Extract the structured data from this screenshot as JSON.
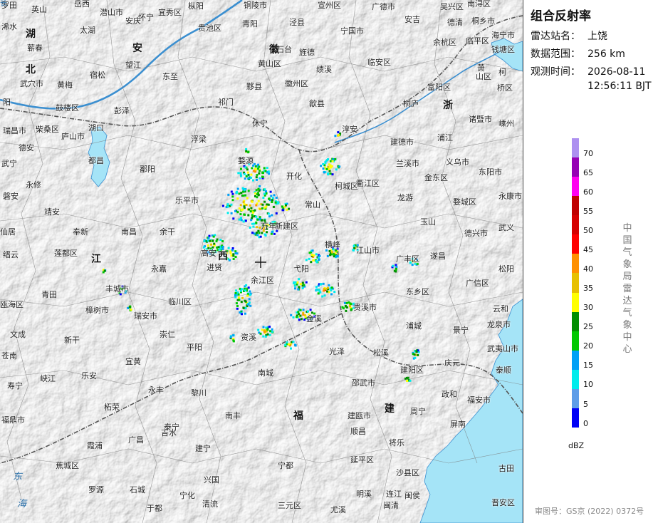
{
  "panel": {
    "title": "组合反射率",
    "station_label": "雷达站名：",
    "station_value": "上饶",
    "range_label": "数据范围：",
    "range_value": "256 km",
    "time_label": "观测时间：",
    "time_date": "2026-08-11",
    "time_clock": "12:56:11 BJT",
    "unit": "dBZ",
    "org": "中国气象局雷达气象中心",
    "approval": "审图号：GS京 (2022) 0372号"
  },
  "legend": {
    "ticks": [
      "70",
      "65",
      "60",
      "55",
      "50",
      "45",
      "40",
      "35",
      "30",
      "25",
      "20",
      "15",
      "10",
      "5",
      "0"
    ],
    "colors": [
      "#ad90f0",
      "#9600b4",
      "#ff00f0",
      "#c00000",
      "#d60000",
      "#ff0000",
      "#ff9000",
      "#e7c000",
      "#ffff00",
      "#008e00",
      "#00c800",
      "#01a0f6",
      "#00ecec",
      "#5d9de8",
      "#0000f6"
    ]
  },
  "colors": {
    "background_terrain": "#d9d9d9",
    "water": "#a5e4f7",
    "boundary": "#6f6f6f"
  },
  "icons": {
    "radar_site": "crosshair-icon"
  },
  "places": [
    {
      "t": "罗田"
    },
    {
      "t": "英山"
    },
    {
      "t": "岳西"
    },
    {
      "t": "潜山市"
    },
    {
      "t": "怀宁"
    },
    {
      "t": "宜秀区"
    },
    {
      "t": "枞阳"
    },
    {
      "t": "铜陵市"
    },
    {
      "t": "宣州区"
    },
    {
      "t": "广德市"
    },
    {
      "t": "吴兴区"
    },
    {
      "t": "南浔区"
    },
    {
      "t": "浠水"
    },
    {
      "t": "湖"
    },
    {
      "t": "太湖"
    },
    {
      "t": "安庆"
    },
    {
      "t": "贵池区"
    },
    {
      "t": "青阳"
    },
    {
      "t": "泾县"
    },
    {
      "t": "宁国市"
    },
    {
      "t": "安吉"
    },
    {
      "t": "德清"
    },
    {
      "t": "桐乡市"
    },
    {
      "t": "海宁市"
    },
    {
      "t": "蕲春"
    },
    {
      "t": "安"
    },
    {
      "t": "望江"
    },
    {
      "t": "石台"
    },
    {
      "t": "黄山区"
    },
    {
      "t": "徽"
    },
    {
      "t": "旌德"
    },
    {
      "t": "余杭区"
    },
    {
      "t": "临平区"
    },
    {
      "t": "钱塘区"
    },
    {
      "t": "北"
    },
    {
      "t": "宿松"
    },
    {
      "t": "东至"
    },
    {
      "t": "绩溪"
    },
    {
      "t": "临安区"
    },
    {
      "t": "萧"
    },
    {
      "t": "柯"
    },
    {
      "t": "武穴市"
    },
    {
      "t": "黄梅"
    },
    {
      "t": "黟县"
    },
    {
      "t": "徽州区"
    },
    {
      "t": "富阳区"
    },
    {
      "t": "山区"
    },
    {
      "t": "桥区"
    },
    {
      "t": "阳"
    },
    {
      "t": "彭泽"
    },
    {
      "t": "祁门"
    },
    {
      "t": "歙县"
    },
    {
      "t": "桐庐"
    },
    {
      "t": "浙"
    },
    {
      "t": "瑞昌市"
    },
    {
      "t": "柴桑区"
    },
    {
      "t": "湖口"
    },
    {
      "t": "休宁"
    },
    {
      "t": "淳安"
    },
    {
      "t": "诸暨市"
    },
    {
      "t": "嵊州"
    },
    {
      "t": "德安"
    },
    {
      "t": "庐山市"
    },
    {
      "t": "浮梁"
    },
    {
      "t": "建德市"
    },
    {
      "t": "浦江"
    },
    {
      "t": "都昌"
    },
    {
      "t": "婺源"
    },
    {
      "t": "兰溪市"
    },
    {
      "t": "义乌市"
    },
    {
      "t": "武宁"
    },
    {
      "t": "鄱阳"
    },
    {
      "t": "开化"
    },
    {
      "t": "金东区"
    },
    {
      "t": "东阳市"
    },
    {
      "t": "永修"
    },
    {
      "t": "乐平市"
    },
    {
      "t": "常山"
    },
    {
      "t": "柯城区"
    },
    {
      "t": "衢江区"
    },
    {
      "t": "龙游"
    },
    {
      "t": "婺城区"
    },
    {
      "t": "永康市"
    },
    {
      "t": "磐安"
    },
    {
      "t": "靖安"
    },
    {
      "t": "新建区"
    },
    {
      "t": "玉山"
    },
    {
      "t": "武义"
    },
    {
      "t": "仙居"
    },
    {
      "t": "奉新"
    },
    {
      "t": "南昌"
    },
    {
      "t": "余干"
    },
    {
      "t": "万年"
    },
    {
      "t": "德兴市"
    },
    {
      "t": "缙云"
    },
    {
      "t": "高安"
    },
    {
      "t": "西"
    },
    {
      "t": "横峰"
    },
    {
      "t": "江山市"
    },
    {
      "t": "遂昌"
    },
    {
      "t": "莲都区"
    },
    {
      "t": "江"
    },
    {
      "t": "进贤"
    },
    {
      "t": "弋阳"
    },
    {
      "t": "广丰区"
    },
    {
      "t": "松阳"
    },
    {
      "t": "永嘉"
    },
    {
      "t": "余江区"
    },
    {
      "t": "广信区"
    },
    {
      "t": "青田"
    },
    {
      "t": "丰城市"
    },
    {
      "t": "东乡区"
    },
    {
      "t": "云和"
    },
    {
      "t": "瓯海区"
    },
    {
      "t": "樟树市"
    },
    {
      "t": "临川区"
    },
    {
      "t": "贵溪市"
    },
    {
      "t": "龙泉市"
    },
    {
      "t": "瑞安市"
    },
    {
      "t": "金溪"
    },
    {
      "t": "浦城"
    },
    {
      "t": "景宁"
    },
    {
      "t": "文成"
    },
    {
      "t": "新干"
    },
    {
      "t": "崇仁"
    },
    {
      "t": "资溪"
    },
    {
      "t": "武夷山市"
    },
    {
      "t": "平阳"
    },
    {
      "t": "光泽"
    },
    {
      "t": "松溪"
    },
    {
      "t": "庆元"
    },
    {
      "t": "泰顺"
    },
    {
      "t": "苍南"
    },
    {
      "t": "峡江"
    },
    {
      "t": "乐安"
    },
    {
      "t": "宜黄"
    },
    {
      "t": "南城"
    },
    {
      "t": "建阳区"
    },
    {
      "t": "寿宁"
    },
    {
      "t": "永丰"
    },
    {
      "t": "黎川"
    },
    {
      "t": "邵武市"
    },
    {
      "t": "政和"
    },
    {
      "t": "柘荣"
    },
    {
      "t": "南丰"
    },
    {
      "t": "福"
    },
    {
      "t": "建瓯市"
    },
    {
      "t": "建"
    },
    {
      "t": "周宁"
    },
    {
      "t": "福安市"
    },
    {
      "t": "福鼎市"
    },
    {
      "t": "吉水"
    },
    {
      "t": "泰宁"
    },
    {
      "t": "顺昌"
    },
    {
      "t": "屏南"
    },
    {
      "t": "霞浦"
    },
    {
      "t": "广昌"
    },
    {
      "t": "建宁"
    },
    {
      "t": "将乐"
    },
    {
      "t": "蕉城区"
    },
    {
      "t": "宁都"
    },
    {
      "t": "延平区"
    },
    {
      "t": "古田"
    },
    {
      "t": "东"
    },
    {
      "t": "兴国"
    },
    {
      "t": "沙县区"
    },
    {
      "t": "罗源"
    },
    {
      "t": "石城"
    },
    {
      "t": "宁化"
    },
    {
      "t": "明溪"
    },
    {
      "t": "闽侯"
    },
    {
      "t": "连江"
    },
    {
      "t": "晋安区"
    },
    {
      "t": "海"
    },
    {
      "t": "于都"
    },
    {
      "t": "清流"
    },
    {
      "t": "三元区"
    },
    {
      "t": "尤溪"
    },
    {
      "t": "闽清"
    },
    {
      "t": "鼓楼区"
    },
    {
      "t": "长"
    }
  ]
}
